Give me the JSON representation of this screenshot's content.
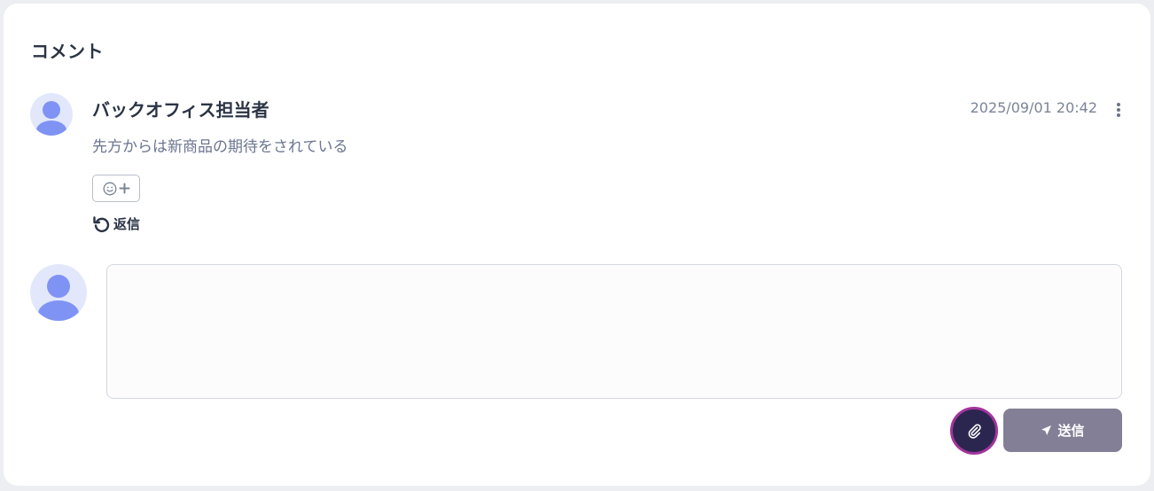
{
  "section": {
    "title": "コメント"
  },
  "comment": {
    "author": "バックオフィス担当者",
    "timestamp": "2025/09/01 20:42",
    "body": "先方からは新商品の期待をされている",
    "reply_label": "返信"
  },
  "composer": {
    "input_value": "",
    "send_label": "送信"
  },
  "icons": {
    "avatar": "user-avatar-icon",
    "more": "kebab-menu-icon",
    "reaction": "smiley-plus-icon",
    "reply": "undo-arrow-icon",
    "attach": "paperclip-icon",
    "send": "paper-plane-icon"
  },
  "colors": {
    "avatar_bg": "#e2e7fb",
    "avatar_fg": "#7f93f5",
    "attach_bg": "#2b2650",
    "attach_ring": "#a2359b",
    "send_bg": "#827f96",
    "text_primary": "#2b3445",
    "text_muted": "#7b8496"
  }
}
